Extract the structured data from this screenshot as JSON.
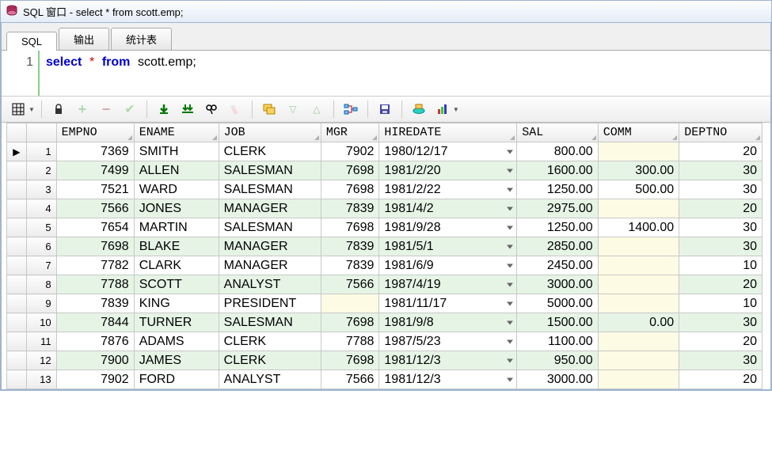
{
  "window": {
    "title": "SQL 窗口 - select * from scott.emp;"
  },
  "tabs": [
    {
      "label": "SQL",
      "active": true
    },
    {
      "label": "输出",
      "active": false
    },
    {
      "label": "统计表",
      "active": false
    }
  ],
  "editor": {
    "line_number": "1",
    "kw_select": "select",
    "star": "*",
    "kw_from": "from",
    "ident": "scott.emp",
    "semicolon": ";"
  },
  "columns": [
    {
      "key": "empno",
      "label": "EMPNO",
      "class": "colEMPNO",
      "align": "num"
    },
    {
      "key": "ename",
      "label": "ENAME",
      "class": "colENAME",
      "align": "txt"
    },
    {
      "key": "job",
      "label": "JOB",
      "class": "colJOB",
      "align": "txt"
    },
    {
      "key": "mgr",
      "label": "MGR",
      "class": "colMGR",
      "align": "num"
    },
    {
      "key": "hiredate",
      "label": "HIREDATE",
      "class": "colHIRE",
      "align": "date"
    },
    {
      "key": "sal",
      "label": "SAL",
      "class": "colSAL",
      "align": "num"
    },
    {
      "key": "comm",
      "label": "COMM",
      "class": "colCOMM",
      "align": "num"
    },
    {
      "key": "deptno",
      "label": "DEPTNO",
      "class": "colDEPT",
      "align": "num"
    }
  ],
  "rows": [
    {
      "n": "1",
      "empno": "7369",
      "ename": "SMITH",
      "job": "CLERK",
      "mgr": "7902",
      "hiredate": "1980/12/17",
      "sal": "800.00",
      "comm": "",
      "deptno": "20"
    },
    {
      "n": "2",
      "empno": "7499",
      "ename": "ALLEN",
      "job": "SALESMAN",
      "mgr": "7698",
      "hiredate": "1981/2/20",
      "sal": "1600.00",
      "comm": "300.00",
      "deptno": "30"
    },
    {
      "n": "3",
      "empno": "7521",
      "ename": "WARD",
      "job": "SALESMAN",
      "mgr": "7698",
      "hiredate": "1981/2/22",
      "sal": "1250.00",
      "comm": "500.00",
      "deptno": "30"
    },
    {
      "n": "4",
      "empno": "7566",
      "ename": "JONES",
      "job": "MANAGER",
      "mgr": "7839",
      "hiredate": "1981/4/2",
      "sal": "2975.00",
      "comm": "",
      "deptno": "20"
    },
    {
      "n": "5",
      "empno": "7654",
      "ename": "MARTIN",
      "job": "SALESMAN",
      "mgr": "7698",
      "hiredate": "1981/9/28",
      "sal": "1250.00",
      "comm": "1400.00",
      "deptno": "30"
    },
    {
      "n": "6",
      "empno": "7698",
      "ename": "BLAKE",
      "job": "MANAGER",
      "mgr": "7839",
      "hiredate": "1981/5/1",
      "sal": "2850.00",
      "comm": "",
      "deptno": "30"
    },
    {
      "n": "7",
      "empno": "7782",
      "ename": "CLARK",
      "job": "MANAGER",
      "mgr": "7839",
      "hiredate": "1981/6/9",
      "sal": "2450.00",
      "comm": "",
      "deptno": "10"
    },
    {
      "n": "8",
      "empno": "7788",
      "ename": "SCOTT",
      "job": "ANALYST",
      "mgr": "7566",
      "hiredate": "1987/4/19",
      "sal": "3000.00",
      "comm": "",
      "deptno": "20"
    },
    {
      "n": "9",
      "empno": "7839",
      "ename": "KING",
      "job": "PRESIDENT",
      "mgr": "",
      "hiredate": "1981/11/17",
      "sal": "5000.00",
      "comm": "",
      "deptno": "10"
    },
    {
      "n": "10",
      "empno": "7844",
      "ename": "TURNER",
      "job": "SALESMAN",
      "mgr": "7698",
      "hiredate": "1981/9/8",
      "sal": "1500.00",
      "comm": "0.00",
      "deptno": "30"
    },
    {
      "n": "11",
      "empno": "7876",
      "ename": "ADAMS",
      "job": "CLERK",
      "mgr": "7788",
      "hiredate": "1987/5/23",
      "sal": "1100.00",
      "comm": "",
      "deptno": "20"
    },
    {
      "n": "12",
      "empno": "7900",
      "ename": "JAMES",
      "job": "CLERK",
      "mgr": "7698",
      "hiredate": "1981/12/3",
      "sal": "950.00",
      "comm": "",
      "deptno": "30"
    },
    {
      "n": "13",
      "empno": "7902",
      "ename": "FORD",
      "job": "ANALYST",
      "mgr": "7566",
      "hiredate": "1981/12/3",
      "sal": "3000.00",
      "comm": "",
      "deptno": "20"
    }
  ],
  "icons": {
    "grid": "grid-icon",
    "lock": "lock-icon",
    "plus": "plus-icon",
    "minus": "minus-icon",
    "check": "check-icon",
    "fetch": "fetch-page-icon",
    "fetchall": "fetch-all-icon",
    "find": "find-icon",
    "clear": "clear-icon",
    "single": "single-record-icon",
    "down": "down-icon",
    "up": "up-icon",
    "linked": "linked-query-icon",
    "save": "save-icon",
    "print": "print-icon",
    "chart": "chart-icon"
  }
}
